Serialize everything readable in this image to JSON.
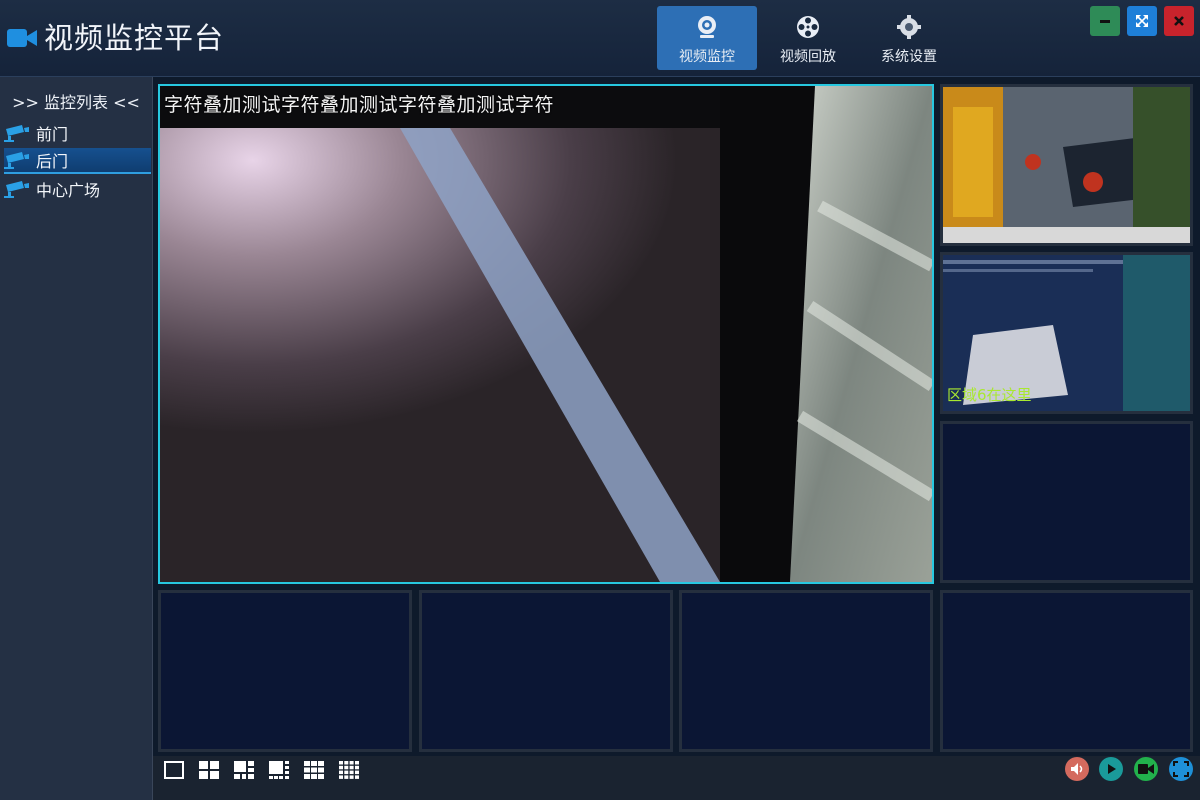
{
  "app": {
    "title": "视频监控平台",
    "accent_color": "#2d6fb5",
    "icon": "video-camera-icon"
  },
  "nav": {
    "items": [
      {
        "label": "视频监控",
        "icon": "webcam-icon",
        "active": true
      },
      {
        "label": "视频回放",
        "icon": "film-reel-icon",
        "active": false
      },
      {
        "label": "系统设置",
        "icon": "gear-icon",
        "active": false
      }
    ]
  },
  "window_controls": {
    "minimize": {
      "icon": "minimize-icon",
      "color": "#2e8b57"
    },
    "fullscreen": {
      "icon": "expand-icon",
      "color": "#1e7fd8"
    },
    "close": {
      "icon": "close-icon",
      "color": "#c8232c"
    }
  },
  "sidebar": {
    "header": ">> 监控列表 <<",
    "items": [
      {
        "label": "前门",
        "icon": "cctv-camera-icon",
        "selected": false
      },
      {
        "label": "后门",
        "icon": "cctv-camera-icon",
        "selected": true
      },
      {
        "label": "中心广场",
        "icon": "cctv-camera-icon",
        "selected": false
      }
    ]
  },
  "video": {
    "main_osd": "字符叠加测试字符叠加测试字符叠加测试字符",
    "thumb2_overlay": "区域6在这里"
  },
  "toolbar": {
    "layouts": [
      "layout-1-icon",
      "layout-4-icon",
      "layout-6-icon",
      "layout-8-icon",
      "layout-9-icon",
      "layout-16-icon"
    ],
    "controls": [
      {
        "icon": "volume-icon",
        "color": "#d46a5e"
      },
      {
        "icon": "play-icon",
        "color": "#1a9a9a"
      },
      {
        "icon": "record-icon",
        "color": "#22b14c"
      },
      {
        "icon": "fullscreen-icon",
        "color": "#1e90d8"
      }
    ]
  }
}
